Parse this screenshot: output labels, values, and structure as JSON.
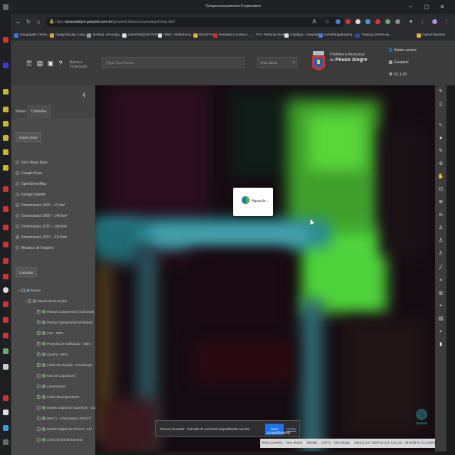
{
  "browser": {
    "window_title": "Geoprocessamento Corporativo",
    "url_prefix": "https://",
    "url_domain": "pousoalegre.geopixel.com.br",
    "url_path": "/geopixelcidades-pousoalegre/map.html"
  },
  "bookmarks": [
    {
      "label": "Geographic Inform...",
      "color": "#3d7bd9"
    },
    {
      "label": "Geografia das Coisa...",
      "color": "#d9a13d"
    },
    {
      "label": "Sci-Hub: removing...",
      "color": "#999999"
    },
    {
      "label": "GeoAPIs/QGIS Pyth...",
      "color": "#dddddd"
    },
    {
      "label": "ABNT | Referência...",
      "color": "#dddddd"
    },
    {
      "label": "REVISTAS",
      "color": "#e0b23a"
    },
    {
      "label": "Permiere | Acesta A...",
      "color": "#cc3333"
    },
    {
      "label": "FGV Portal do Aluno",
      "color": "#333333"
    },
    {
      "label": "Catalogo - Geopixel",
      "color": "#dddddd"
    },
    {
      "label": "somethingaboutma...",
      "color": "#4b7bd9"
    },
    {
      "label": "Training | NASA Ap...",
      "color": "#2a4fa0"
    },
    {
      "label": "Outros favoritos",
      "color": "#e0b23a"
    }
  ],
  "header": {
    "search_placeholder": "Busca e localização",
    "filter_placeholder": "Digite Aqui Busca",
    "area_select": "Área Aberta",
    "org_line1": "Prefeitura Municipal",
    "org_line2": "de",
    "org_line3": "Pouso Alegre",
    "user_name": "Weber santos",
    "user_org": "Geopixel",
    "version": "V2.1.20"
  },
  "sidebar": {
    "tabs": [
      "Mapas",
      "Camadas"
    ],
    "basemaps_button": "Mapas Base",
    "basemaps": [
      {
        "label": "Sem Mapa Base",
        "selected": false
      },
      {
        "label": "Google Ruas",
        "selected": false
      },
      {
        "label": "OpenStreetMap",
        "selected": false
      },
      {
        "label": "Google Satelite",
        "selected": false
      },
      {
        "label": "Ortomosaico 2000 – 15 km²",
        "selected": false
      },
      {
        "label": "Ortomosaico 2000 – 145 km²",
        "selected": false
      },
      {
        "label": "Ortomosaico 2015 – 160 km²",
        "selected": false
      },
      {
        "label": "Ortomosaico 2023 – 210 km²",
        "selected": true
      },
      {
        "label": "Mosaico de Imagens",
        "selected": false
      }
    ],
    "layers_button": "Camadas",
    "tree": [
      {
        "label": "Mapas",
        "indent": 0,
        "checked": false
      },
      {
        "label": "Mapas do Município",
        "indent": 1,
        "checked": false
      },
      {
        "label": "Plantas Loteamentos (Adicional)",
        "indent": 2,
        "checked": true
      },
      {
        "label": "Plantas Digitalizadas (Editadas)",
        "indent": 2,
        "checked": true
      },
      {
        "label": "Lote - MDU",
        "indent": 2,
        "checked": true
      },
      {
        "label": "Projeção de Edificação - MDU",
        "indent": 2,
        "checked": true
      },
      {
        "label": "Quadra - MDU",
        "indent": 2,
        "checked": true
      },
      {
        "label": "Limite de Atuação - Atualização",
        "indent": 2,
        "checked": true
      },
      {
        "label": "Eixo de Logradouro",
        "indent": 2,
        "checked": false
      },
      {
        "label": "Loteamentos",
        "indent": 2,
        "checked": false
      },
      {
        "label": "Limite Municipal IBGE",
        "indent": 2,
        "checked": true
      },
      {
        "label": "Modelo Digital de Superfície - 2023",
        "indent": 2,
        "checked": false
      },
      {
        "label": "DM C1 - Ortomosaico 2023 07",
        "indent": 2,
        "checked": false
      },
      {
        "label": "Modelo Digital de Terreno - 10/",
        "indent": 2,
        "checked": false
      },
      {
        "label": "Limite de Monitoramento",
        "indent": 2,
        "checked": false
      }
    ]
  },
  "loading": {
    "text": "Aguarde..."
  },
  "share": {
    "message": "Screen Recorder - Gravador de ecrã está compartilhando sua tela.",
    "stop_label": "Parar compartilhamento",
    "hide_label": "Ocultar"
  },
  "status": {
    "theme_label": "Tema Corrente:",
    "theme_value": "Área Aberta",
    "scale_label": "Escala:",
    "scale_value": "1:9771",
    "utm_label": "Utm Sirgas:",
    "utm_value": "404211.216 7539734.224",
    "lonlat_label": "Lon,Lat:",
    "lonlat_value": "-45.928375 -22.243236"
  },
  "colors": {
    "accent_blue": "#1a73e8",
    "map_green": "#4fd33a",
    "map_cyan": "#3fa7b6"
  }
}
